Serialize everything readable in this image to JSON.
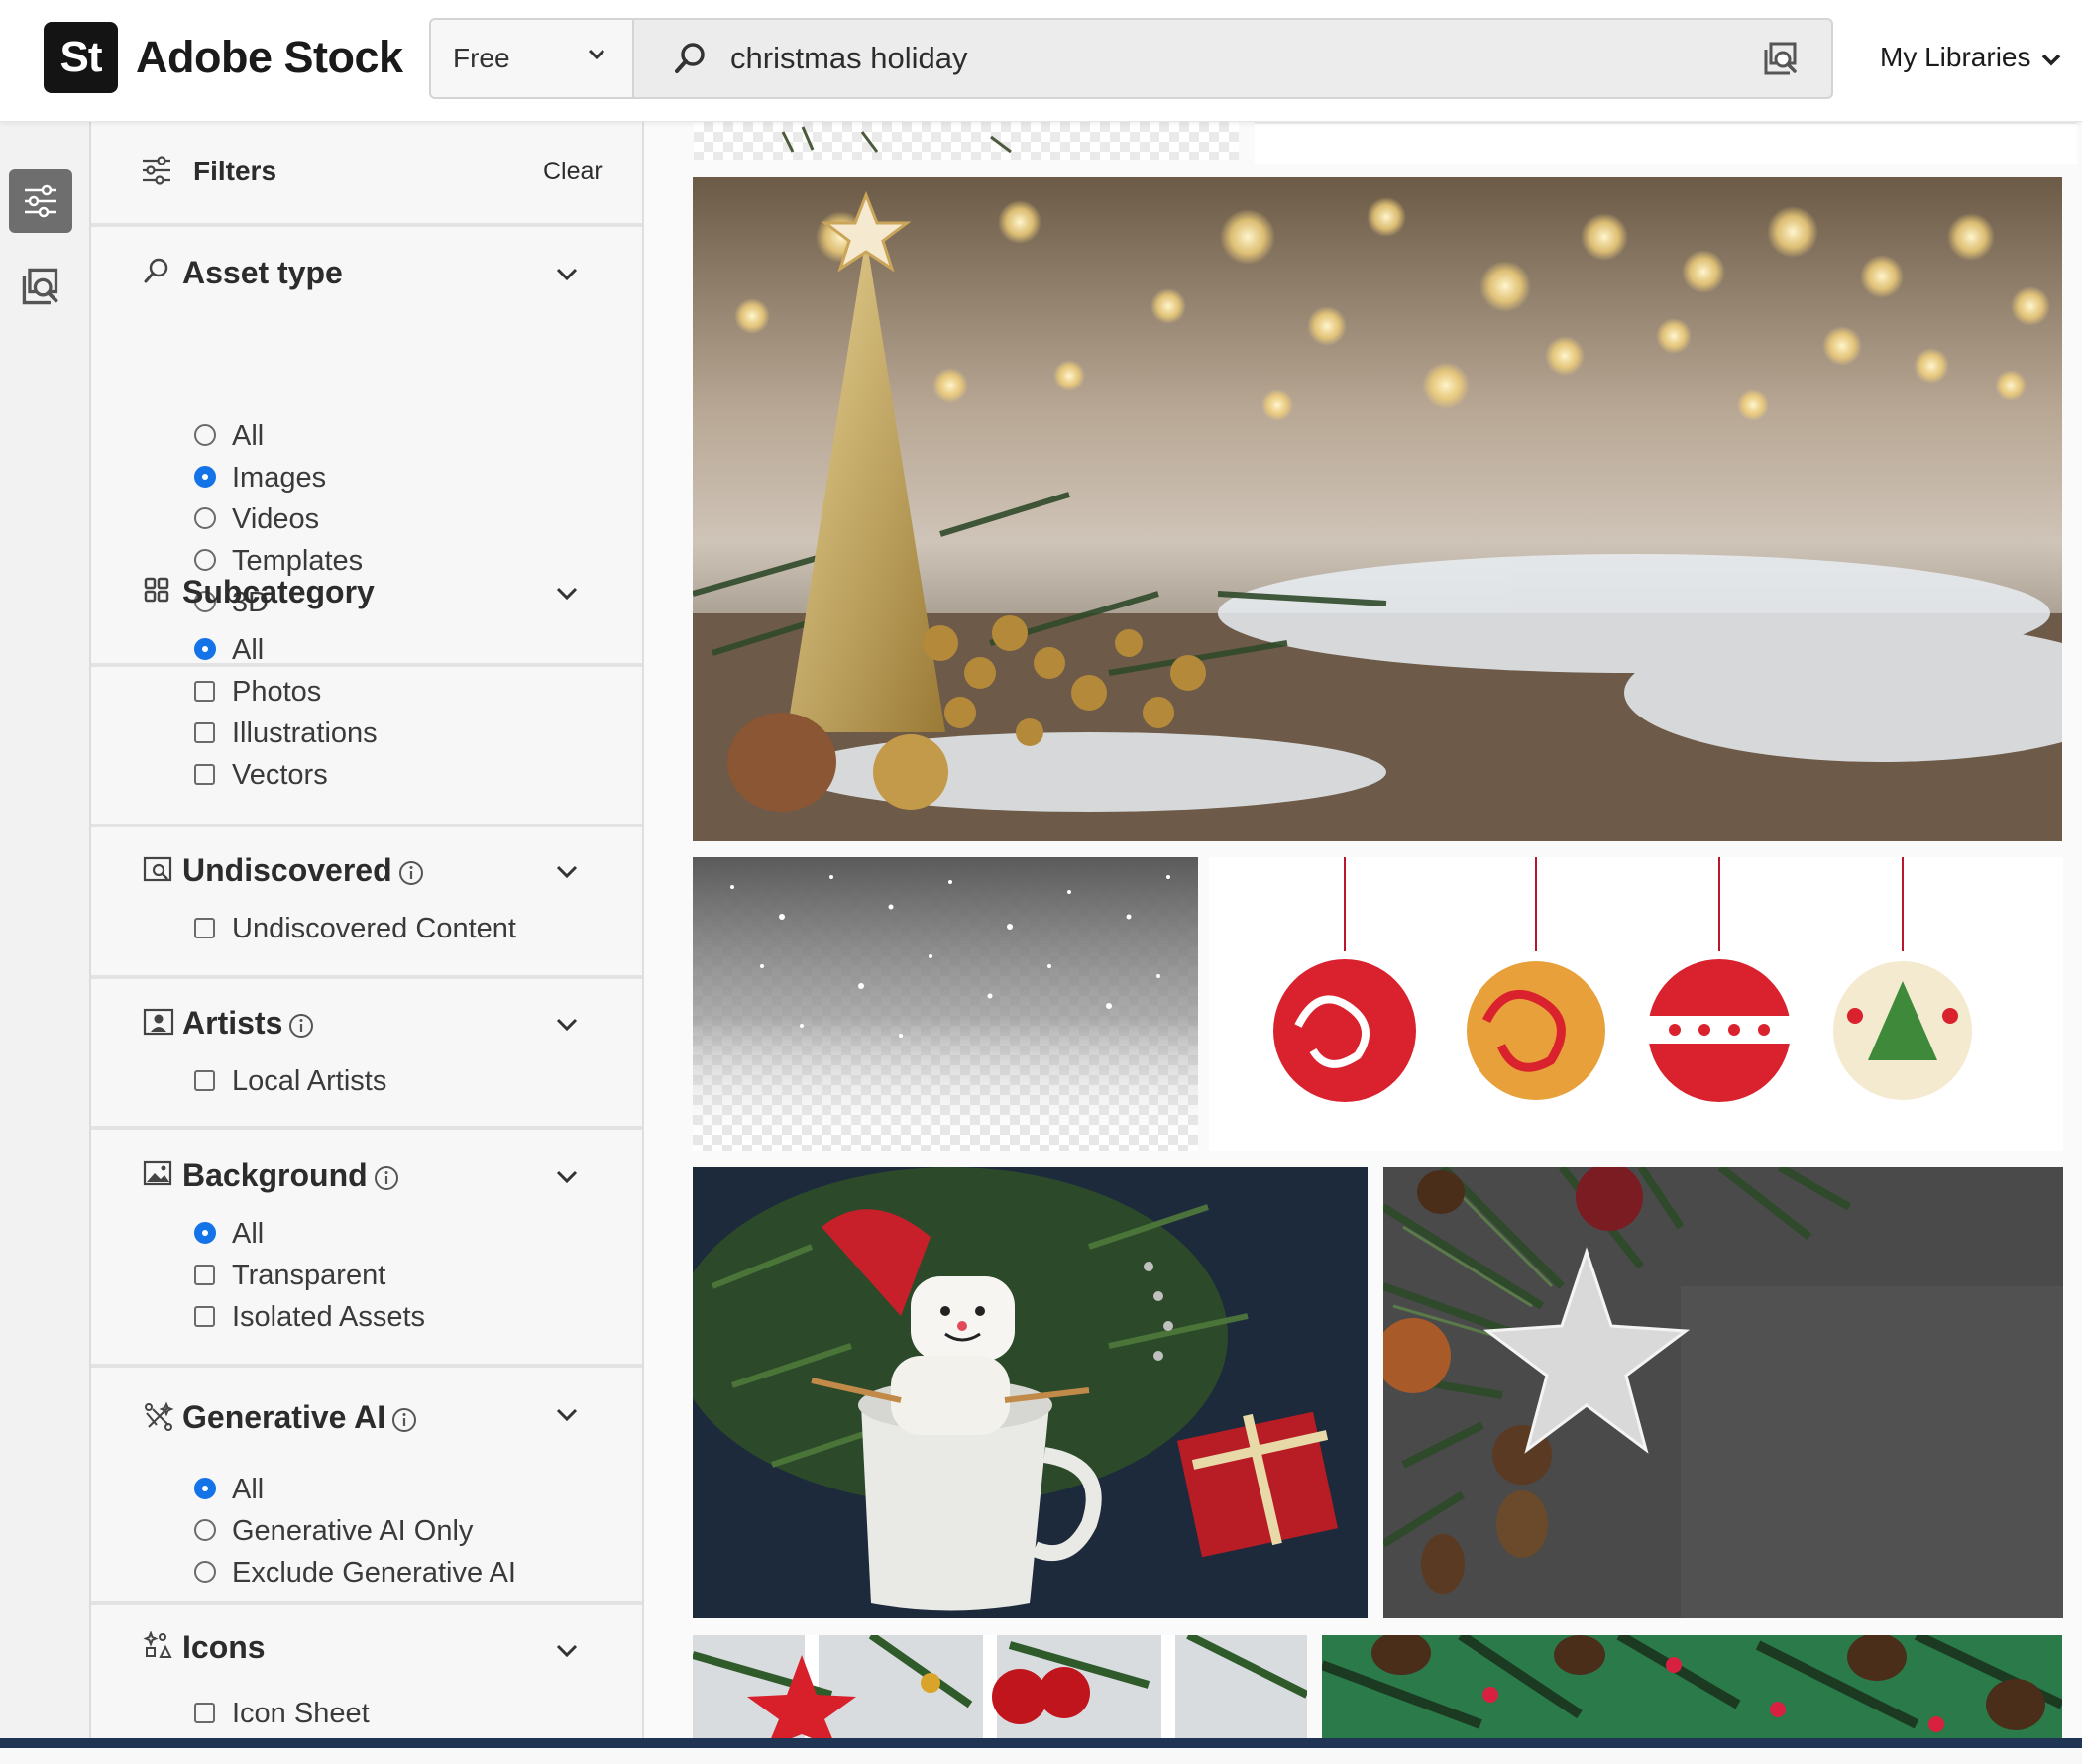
{
  "app": {
    "logo_text": "St",
    "brand_name": "Adobe Stock"
  },
  "search": {
    "type_selected": "Free",
    "query": "christmas holiday"
  },
  "header": {
    "my_libraries_label": "My Libraries"
  },
  "filters": {
    "title": "Filters",
    "clear_label": "Clear",
    "sections": {
      "asset_type": {
        "title": "Asset type",
        "options": [
          "All",
          "Images",
          "Videos",
          "Templates",
          "3D"
        ],
        "selected": "Images"
      },
      "subcategory": {
        "title": "Subcategory",
        "options": [
          "All",
          "Photos",
          "Illustrations",
          "Vectors"
        ],
        "selected": "All"
      },
      "undiscovered": {
        "title": "Undiscovered",
        "options": [
          "Undiscovered Content"
        ]
      },
      "artists": {
        "title": "Artists",
        "options": [
          "Local Artists"
        ]
      },
      "background": {
        "title": "Background",
        "options": [
          "All",
          "Transparent",
          "Isolated Assets"
        ],
        "selected": "All"
      },
      "generative_ai": {
        "title": "Generative AI",
        "options": [
          "All",
          "Generative AI Only",
          "Exclude Generative AI"
        ],
        "selected": "All"
      },
      "icons": {
        "title": "Icons",
        "options": [
          "Icon Sheet"
        ]
      }
    }
  },
  "results": {
    "tiles": [
      "gold-christmas-tree-bokeh-photo",
      "falling-snow-transparent-overlay",
      "red-christmas-ornaments-illustration",
      "marshmallow-snowman-mug-photo",
      "silver-star-fir-branches-photo",
      "red-star-baubles-fir-photo",
      "fir-branches-pinecones-green-photo"
    ]
  },
  "colors": {
    "accent": "#1473e6",
    "logo_bg": "#141414",
    "footer": "#1f3553"
  }
}
